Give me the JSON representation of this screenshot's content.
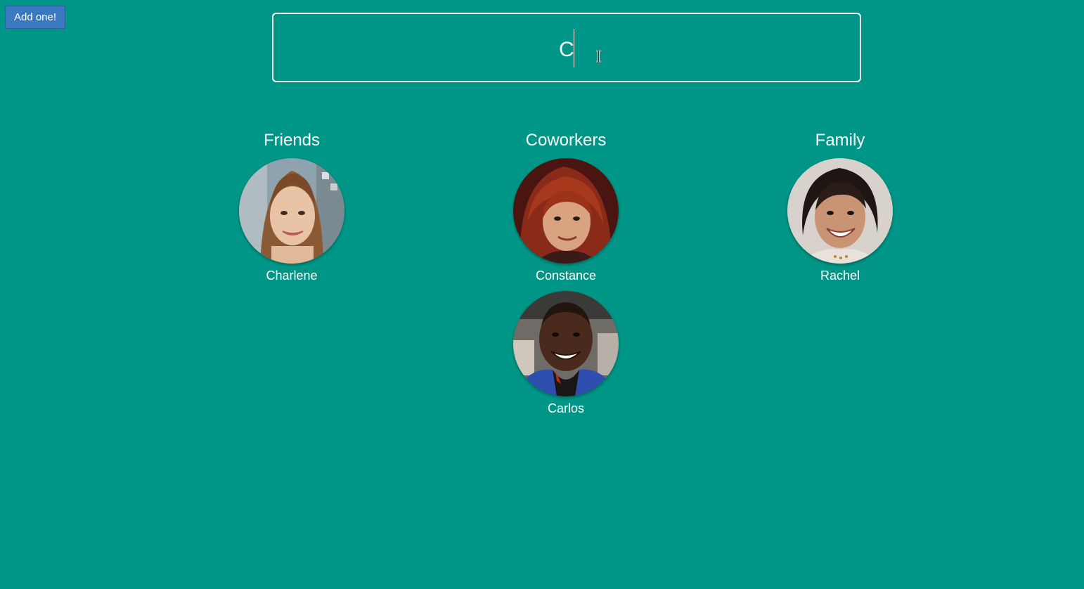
{
  "toolbar": {
    "add_label": "Add one!"
  },
  "search": {
    "value": "C"
  },
  "groups": [
    {
      "title": "Friends",
      "people": [
        {
          "name": "Charlene"
        }
      ]
    },
    {
      "title": "Coworkers",
      "people": [
        {
          "name": "Constance"
        },
        {
          "name": "Carlos"
        }
      ]
    },
    {
      "title": "Family",
      "people": [
        {
          "name": "Rachel"
        }
      ]
    }
  ],
  "colors": {
    "background": "#009687",
    "button": "#3a78c0",
    "text": "#ffffff"
  }
}
